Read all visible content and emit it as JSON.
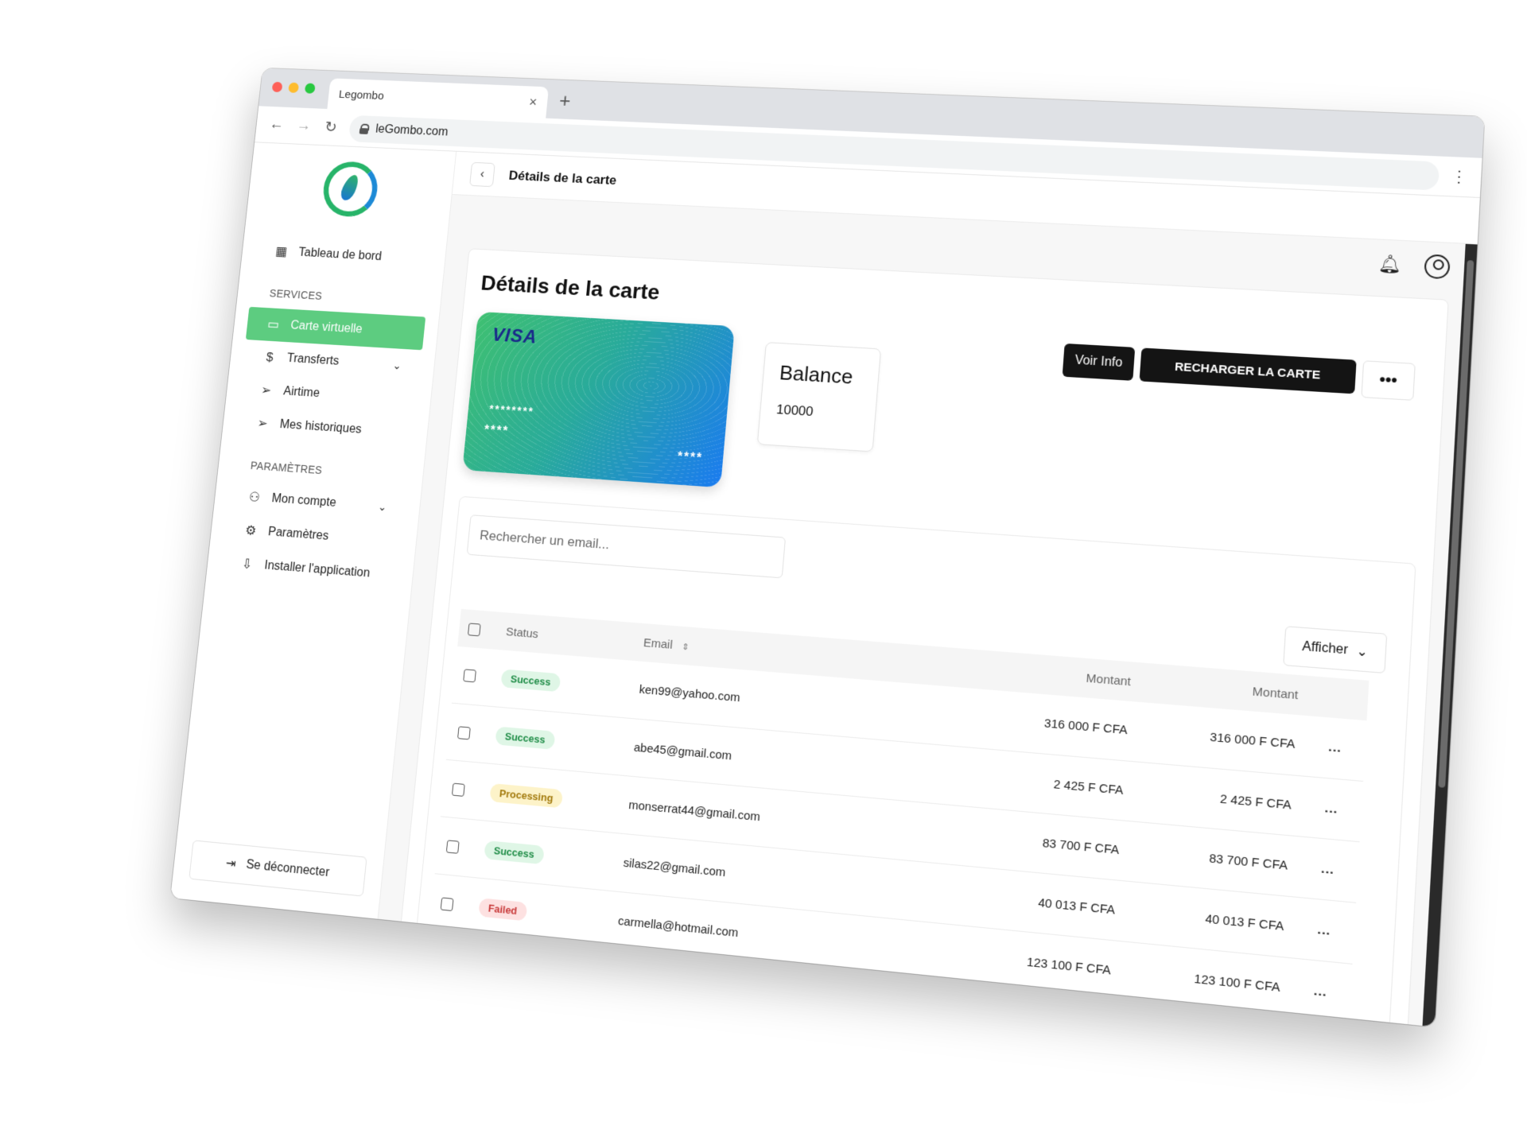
{
  "browser": {
    "tab_title": "Legombo",
    "tab_close": "×",
    "new_tab": "+",
    "url": "leGombo.com"
  },
  "sidebar": {
    "items": [
      {
        "label": "Tableau de bord",
        "icon": "grid-icon"
      },
      {
        "label": "Carte virtuelle",
        "icon": "card-icon"
      },
      {
        "label": "Transferts",
        "icon": "transfer-icon"
      },
      {
        "label": "Airtime",
        "icon": "send-icon"
      },
      {
        "label": "Mes historiques",
        "icon": "send-icon"
      },
      {
        "label": "Mon compte",
        "icon": "users-icon"
      },
      {
        "label": "Paramètres",
        "icon": "gear-icon"
      },
      {
        "label": "Installer l'application",
        "icon": "install-icon"
      }
    ],
    "section_services": "SERVICES",
    "section_parametres": "PARAMÈTRES",
    "logout": "Se déconnecter",
    "active_color": "#5dcc80"
  },
  "topbar": {
    "title": "Détails de la carte"
  },
  "panel": {
    "title": "Détails de la carte",
    "voir_info": "Voir Info",
    "recharger": "RECHARGER LA CARTE",
    "more": "•••"
  },
  "card": {
    "brand": "VISA",
    "mask_line1": "********",
    "mask_line2": "****",
    "mask_line3": "****"
  },
  "balance": {
    "title": "Balance",
    "value": "10000"
  },
  "table": {
    "search_placeholder": "Rechercher un email...",
    "afficher": "Afficher",
    "headers": {
      "status": "Status",
      "email": "Email",
      "montant1": "Montant",
      "montant2": "Montant"
    },
    "rows": [
      {
        "status": "Success",
        "email": "ken99@yahoo.com",
        "montant1": "316 000 F CFA",
        "montant2": "316 000 F CFA",
        "more": "..."
      },
      {
        "status": "Success",
        "email": "abe45@gmail.com",
        "montant1": "2 425 F CFA",
        "montant2": "2 425 F CFA",
        "more": "..."
      },
      {
        "status": "Processing",
        "email": "monserrat44@gmail.com",
        "montant1": "83 700 F CFA",
        "montant2": "83 700 F CFA",
        "more": "..."
      },
      {
        "status": "Success",
        "email": "silas22@gmail.com",
        "montant1": "40 013 F CFA",
        "montant2": "40 013 F CFA",
        "more": "..."
      },
      {
        "status": "Failed",
        "email": "carmella@hotmail.com",
        "montant1": "123 100 F CFA",
        "montant2": "123 100 F CFA",
        "more": "..."
      }
    ]
  }
}
